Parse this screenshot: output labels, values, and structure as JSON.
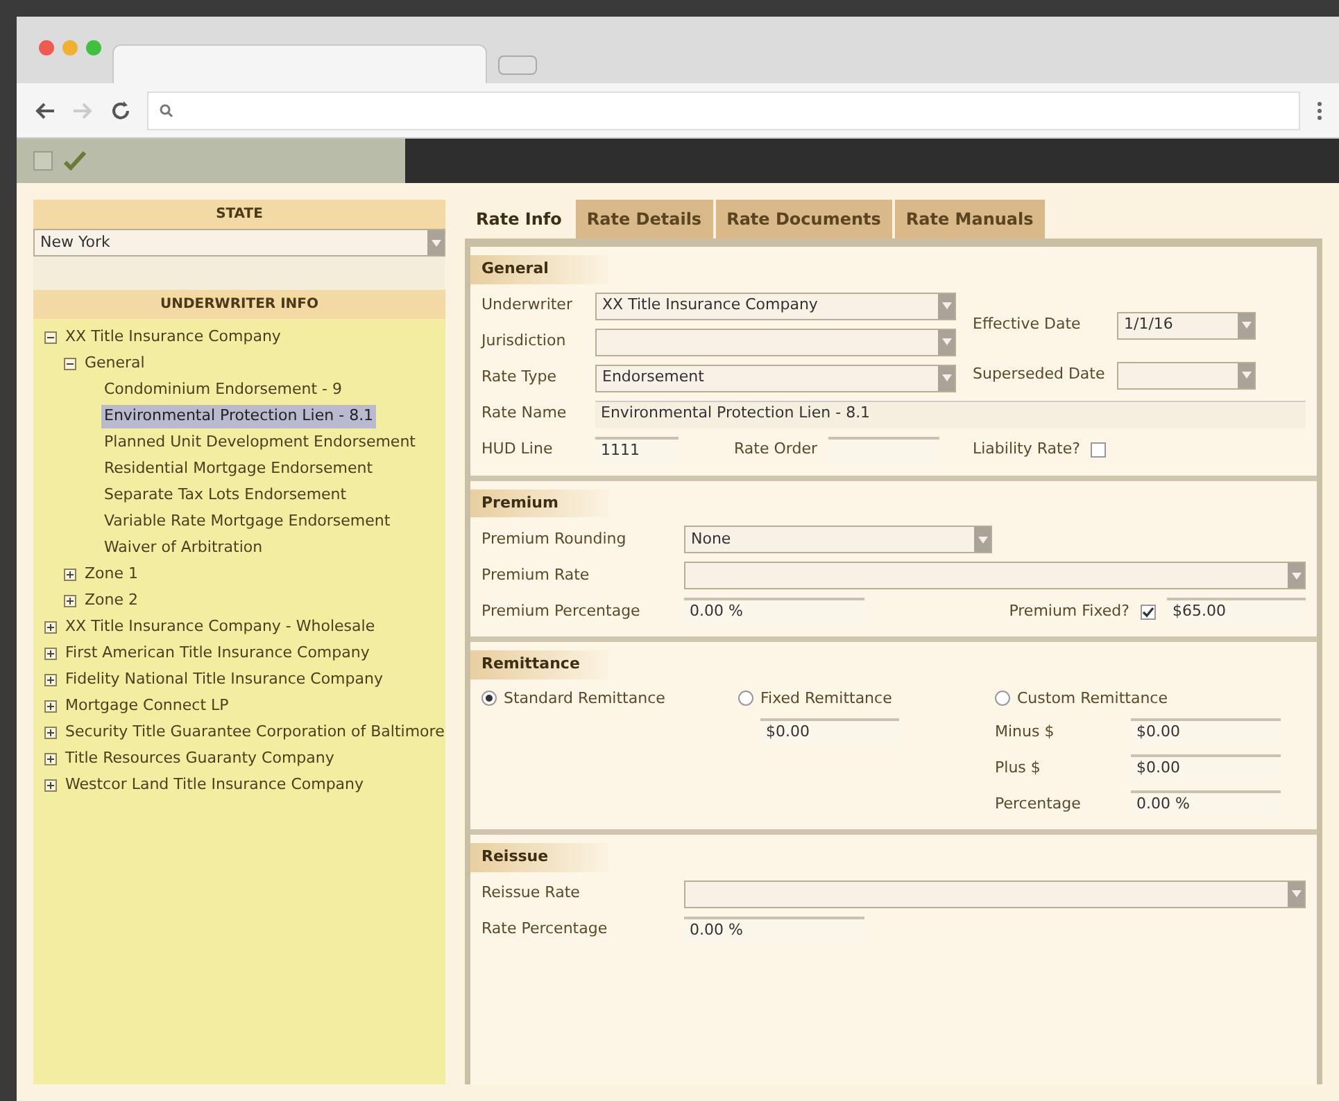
{
  "left": {
    "state_header": "STATE",
    "state_value": "New York",
    "uw_header": "UNDERWRITER INFO",
    "tree": [
      {
        "label": "XX Title Insurance Company",
        "expanded": true,
        "selected": false,
        "children": [
          {
            "label": "General",
            "expanded": true,
            "selected": false,
            "children": [
              {
                "label": "Condominium Endorsement - 9",
                "selected": false
              },
              {
                "label": "Environmental Protection Lien - 8.1",
                "selected": true
              },
              {
                "label": "Planned Unit Development Endorsement",
                "selected": false
              },
              {
                "label": "Residential Mortgage Endorsement",
                "selected": false
              },
              {
                "label": "Separate Tax Lots Endorsement",
                "selected": false
              },
              {
                "label": "Variable Rate Mortgage Endorsement",
                "selected": false
              },
              {
                "label": "Waiver of Arbitration",
                "selected": false
              }
            ]
          },
          {
            "label": "Zone 1",
            "expanded": false,
            "selected": false
          },
          {
            "label": "Zone 2",
            "expanded": false,
            "selected": false
          }
        ]
      },
      {
        "label": "XX Title Insurance Company - Wholesale",
        "expanded": false,
        "selected": false
      },
      {
        "label": "First American Title Insurance Company",
        "expanded": false,
        "selected": false
      },
      {
        "label": "Fidelity National Title Insurance Company",
        "expanded": false,
        "selected": false
      },
      {
        "label": "Mortgage Connect LP",
        "expanded": false,
        "selected": false
      },
      {
        "label": "Security Title Guarantee Corporation of Baltimore",
        "expanded": false,
        "selected": false
      },
      {
        "label": "Title Resources Guaranty Company",
        "expanded": false,
        "selected": false
      },
      {
        "label": "Westcor Land Title Insurance Company",
        "expanded": false,
        "selected": false
      }
    ]
  },
  "tabs": [
    {
      "label": "Rate Info",
      "selected": true
    },
    {
      "label": "Rate Details",
      "selected": false
    },
    {
      "label": "Rate Documents",
      "selected": false
    },
    {
      "label": "Rate Manuals",
      "selected": false
    }
  ],
  "general": {
    "title": "General",
    "underwriter": {
      "label": "Underwriter",
      "value": "XX Title Insurance Company"
    },
    "jurisdiction": {
      "label": "Jurisdiction"
    },
    "rate_type": {
      "label": "Rate Type",
      "value": "Endorsement"
    },
    "effective_date": {
      "label": "Effective Date",
      "value": "1/1/16"
    },
    "superseded_date": {
      "label": "Superseded Date"
    },
    "rate_name": {
      "label": "Rate Name",
      "value": "Environmental Protection Lien - 8.1"
    },
    "hud_line": {
      "label": "HUD Line",
      "value": "1111"
    },
    "rate_order": {
      "label": "Rate Order"
    },
    "liability_rate": {
      "label": "Liability Rate?",
      "checked": false
    }
  },
  "premium": {
    "title": "Premium",
    "rounding": {
      "label": "Premium Rounding",
      "value": "None"
    },
    "rate": {
      "label": "Premium Rate"
    },
    "percentage": {
      "label": "Premium Percentage",
      "value": "0.00 %"
    },
    "fixed": {
      "label": "Premium Fixed?",
      "checked": true,
      "value": "$65.00"
    }
  },
  "remittance": {
    "title": "Remittance",
    "options": [
      {
        "label": "Standard Remittance",
        "selected": true
      },
      {
        "label": "Fixed Remittance",
        "selected": false
      },
      {
        "label": "Custom Remittance",
        "selected": false
      }
    ],
    "fixed_value": "$0.00",
    "custom": [
      {
        "label": "Minus $",
        "value": "$0.00"
      },
      {
        "label": "Plus $",
        "value": "$0.00"
      },
      {
        "label": "Percentage",
        "value": "0.00 %"
      }
    ]
  },
  "reissue": {
    "title": "Reissue",
    "rate": {
      "label": "Reissue Rate"
    },
    "percentage": {
      "label": "Rate Percentage",
      "value": "0.00 %"
    }
  }
}
